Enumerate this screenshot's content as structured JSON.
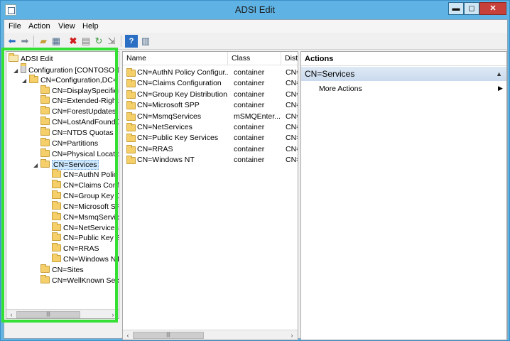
{
  "window": {
    "title": "ADSI Edit",
    "min_label": "▬",
    "max_label": "◻",
    "close_label": "✕"
  },
  "menu": [
    "File",
    "Action",
    "View",
    "Help"
  ],
  "toolbar_icons": [
    "back-arrow-icon",
    "forward-arrow-icon",
    "up-folder-icon",
    "show-hide-console-tree-icon",
    "delete-icon",
    "properties-icon",
    "refresh-icon",
    "export-list-icon",
    "help-icon",
    "show-hide-action-pane-icon"
  ],
  "tree": [
    {
      "label": "ADSI Edit",
      "level": 0,
      "expander": "",
      "icon": "adsi-edit-icon"
    },
    {
      "label": "Configuration [CONTOSO-D",
      "level": 1,
      "expander": "◢",
      "icon": "server-icon"
    },
    {
      "label": "CN=Configuration,DC=",
      "level": 2,
      "expander": "◢",
      "icon": "folder-icon"
    },
    {
      "label": "CN=DisplaySpecifier",
      "level": 3,
      "expander": "",
      "icon": "folder-icon"
    },
    {
      "label": "CN=Extended-Rights",
      "level": 3,
      "expander": "",
      "icon": "folder-icon"
    },
    {
      "label": "CN=ForestUpdates",
      "level": 3,
      "expander": "",
      "icon": "folder-icon"
    },
    {
      "label": "CN=LostAndFoundC",
      "level": 3,
      "expander": "",
      "icon": "folder-icon"
    },
    {
      "label": "CN=NTDS Quotas",
      "level": 3,
      "expander": "",
      "icon": "folder-icon"
    },
    {
      "label": "CN=Partitions",
      "level": 3,
      "expander": "",
      "icon": "folder-icon"
    },
    {
      "label": "CN=Physical Locatio",
      "level": 3,
      "expander": "",
      "icon": "folder-icon"
    },
    {
      "label": "CN=Services",
      "level": 3,
      "expander": "◢",
      "icon": "folder-icon",
      "selected": true
    },
    {
      "label": "CN=AuthN Polic",
      "level": 4,
      "expander": "",
      "icon": "folder-icon"
    },
    {
      "label": "CN=Claims Conf",
      "level": 4,
      "expander": "",
      "icon": "folder-icon"
    },
    {
      "label": "CN=Group Key D",
      "level": 4,
      "expander": "",
      "icon": "folder-icon"
    },
    {
      "label": "CN=Microsoft SP",
      "level": 4,
      "expander": "",
      "icon": "folder-icon"
    },
    {
      "label": "CN=MsmqServic",
      "level": 4,
      "expander": "",
      "icon": "folder-icon"
    },
    {
      "label": "CN=NetServices",
      "level": 4,
      "expander": "",
      "icon": "folder-icon"
    },
    {
      "label": "CN=Public Key S",
      "level": 4,
      "expander": "",
      "icon": "folder-icon"
    },
    {
      "label": "CN=RRAS",
      "level": 4,
      "expander": "",
      "icon": "folder-icon"
    },
    {
      "label": "CN=Windows NT",
      "level": 4,
      "expander": "",
      "icon": "folder-icon"
    },
    {
      "label": "CN=Sites",
      "level": 3,
      "expander": "",
      "icon": "folder-icon"
    },
    {
      "label": "CN=WellKnown Secu",
      "level": 3,
      "expander": "",
      "icon": "folder-icon"
    }
  ],
  "list": {
    "columns": [
      "Name",
      "Class",
      "Disti"
    ],
    "rows": [
      {
        "name": "CN=AuthN Policy Configur...",
        "class": "container",
        "dn": "CN="
      },
      {
        "name": "CN=Claims Configuration",
        "class": "container",
        "dn": "CN="
      },
      {
        "name": "CN=Group Key Distribution...",
        "class": "container",
        "dn": "CN="
      },
      {
        "name": "CN=Microsoft SPP",
        "class": "container",
        "dn": "CN="
      },
      {
        "name": "CN=MsmqServices",
        "class": "mSMQEnter...",
        "dn": "CN="
      },
      {
        "name": "CN=NetServices",
        "class": "container",
        "dn": "CN="
      },
      {
        "name": "CN=Public Key Services",
        "class": "container",
        "dn": "CN="
      },
      {
        "name": "CN=RRAS",
        "class": "container",
        "dn": "CN="
      },
      {
        "name": "CN=Windows NT",
        "class": "container",
        "dn": "CN="
      }
    ]
  },
  "actions": {
    "header": "Actions",
    "section": "CN=Services",
    "section_caret": "▲",
    "items": [
      "More Actions"
    ],
    "item_arrow": "▶"
  },
  "scroll": {
    "left_arrow": "‹",
    "right_arrow": "›",
    "thumb": "|||"
  },
  "colors": {
    "highlight": "#35e035",
    "titlebar": "#5fb3e4"
  }
}
